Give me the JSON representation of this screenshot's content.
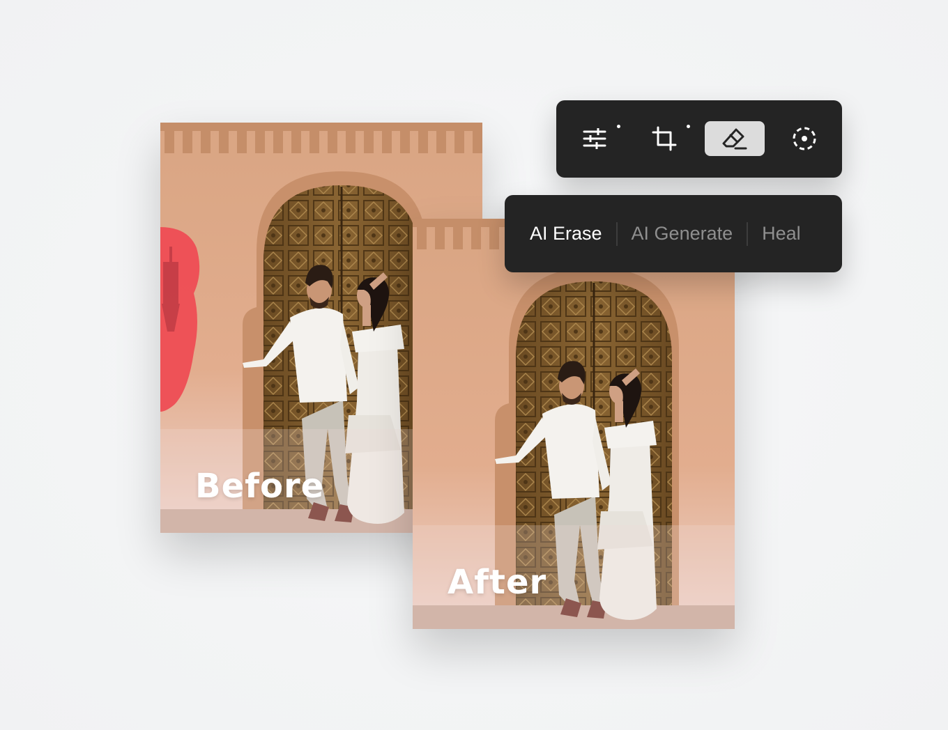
{
  "photos": {
    "before_label": "Before",
    "after_label": "After"
  },
  "toolbar": {
    "tools": [
      {
        "name": "adjust-icon",
        "active": false,
        "has_dot": true
      },
      {
        "name": "crop-icon",
        "active": false,
        "has_dot": true
      },
      {
        "name": "eraser-icon",
        "active": true,
        "has_dot": false
      },
      {
        "name": "dashed-circle-select-icon",
        "active": false,
        "has_dot": false
      }
    ]
  },
  "modes": {
    "ai_erase": "AI Erase",
    "ai_generate": "AI Generate",
    "heal": "Heal",
    "active": "AI Erase"
  },
  "colors": {
    "toolbar_bg": "#242424",
    "active_tool_bg": "#dcdcdc",
    "erase_mask": "#ef4a52",
    "wall": "#d4a07a"
  }
}
